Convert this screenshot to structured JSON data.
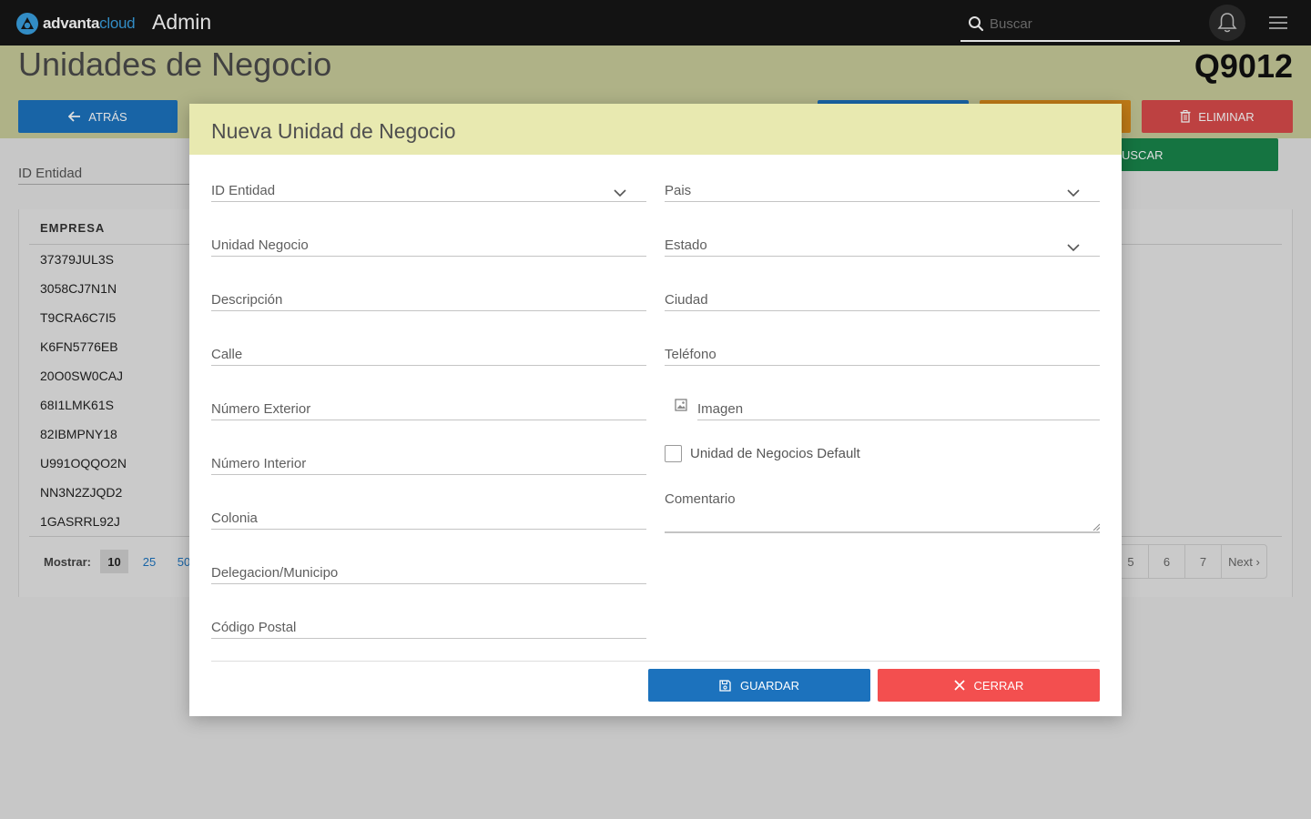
{
  "topbar": {
    "logo_text_a": "advanta",
    "logo_text_b": "cloud",
    "app_name": "Admin",
    "search_placeholder": "Buscar"
  },
  "page": {
    "title": "Unidades de Negocio",
    "code": "Q9012",
    "back_label": "ATRÁS",
    "delete_label": "ELIMINAR",
    "search_label": "USCAR",
    "filter_label": "ID Entidad"
  },
  "table": {
    "column_header": "EMPRESA",
    "rows": [
      "37379JUL3S",
      "3058CJ7N1N",
      "T9CRA6C7I5",
      "K6FN5776EB",
      "20O0SW0CAJ",
      "68I1LMK61S",
      "82IBMPNY18",
      "U991OQQO2N",
      "NN3N2ZJQD2",
      "1GASRRL92J"
    ],
    "show_label": "Mostrar:",
    "show_options": [
      "10",
      "25",
      "50"
    ],
    "pages": [
      "5",
      "6",
      "7",
      "Next ›"
    ]
  },
  "modal": {
    "title": "Nueva Unidad de Negocio",
    "left_fields": [
      "ID Entidad",
      "Unidad Negocio",
      "Descripción",
      "Calle",
      "Número Exterior",
      "Número Interior",
      "Colonia",
      "Delegacion/Municipo",
      "Código Postal"
    ],
    "right_fields": [
      "Pais",
      "Estado",
      "Ciudad",
      "Teléfono",
      "Imagen"
    ],
    "checkbox_label": "Unidad de Negocios Default",
    "comment_label": "Comentario",
    "save_label": "GUARDAR",
    "close_label": "CERRAR"
  },
  "colors": {
    "topbar": "#161616",
    "header_band": "#c8cb9a",
    "modal_header": "#e8e9b0",
    "primary": "#1c72bd",
    "danger": "#f34f4f",
    "success": "#18844b",
    "warning": "#d88a1a"
  }
}
